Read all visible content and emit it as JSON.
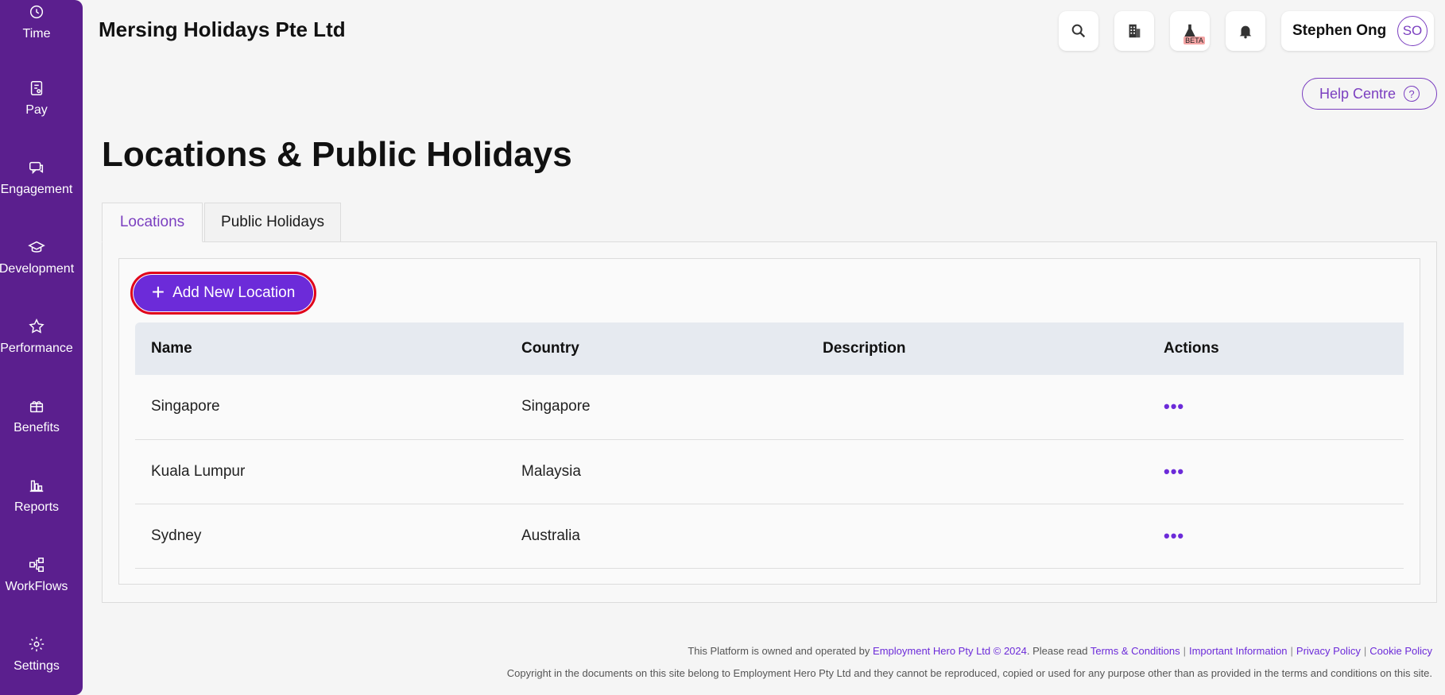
{
  "sidebar": {
    "items": [
      {
        "label": "Time",
        "icon": "clock-money-icon"
      },
      {
        "label": "Pay",
        "icon": "payslip-icon"
      },
      {
        "label": "Engagement",
        "icon": "chat-icon"
      },
      {
        "label": "Development",
        "icon": "graduation-cap-icon"
      },
      {
        "label": "Performance",
        "icon": "star-icon"
      },
      {
        "label": "Benefits",
        "icon": "gift-icon"
      },
      {
        "label": "Reports",
        "icon": "bar-chart-icon"
      },
      {
        "label": "WorkFlows",
        "icon": "workflow-icon"
      },
      {
        "label": "Settings",
        "icon": "gear-icon"
      }
    ]
  },
  "header": {
    "company": "Mersing Holidays Pte Ltd",
    "beta_badge": "BETA",
    "user_name": "Stephen Ong",
    "user_initials": "SO",
    "help_label": "Help Centre",
    "help_icon_glyph": "?"
  },
  "page": {
    "title": "Locations & Public Holidays"
  },
  "tabs": [
    {
      "label": "Locations",
      "active": true
    },
    {
      "label": "Public Holidays",
      "active": false
    }
  ],
  "locations": {
    "add_button": "Add New Location",
    "columns": [
      "Name",
      "Country",
      "Description",
      "Actions"
    ],
    "rows": [
      {
        "name": "Singapore",
        "country": "Singapore",
        "description": "",
        "actions": "•••"
      },
      {
        "name": "Kuala Lumpur",
        "country": "Malaysia",
        "description": "",
        "actions": "•••"
      },
      {
        "name": "Sydney",
        "country": "Australia",
        "description": "",
        "actions": "•••"
      }
    ]
  },
  "footer": {
    "line1_prefix": "This Platform is owned and operated by ",
    "company_link": "Employment Hero Pty Ltd © 2024",
    "line1_mid": ". Please read ",
    "links": [
      "Terms & Conditions",
      "Important Information",
      "Privacy Policy",
      "Cookie Policy"
    ],
    "line2": "Copyright in the documents on this site belong to Employment Hero Pty Ltd and they cannot be reproduced, copied or used for any purpose other than as provided in the terms and conditions on this site."
  },
  "colors": {
    "sidebar": "#5b1f8e",
    "accent": "#6c2bd9",
    "highlight_outline": "#e0001a",
    "table_header": "#e6eaf0"
  }
}
